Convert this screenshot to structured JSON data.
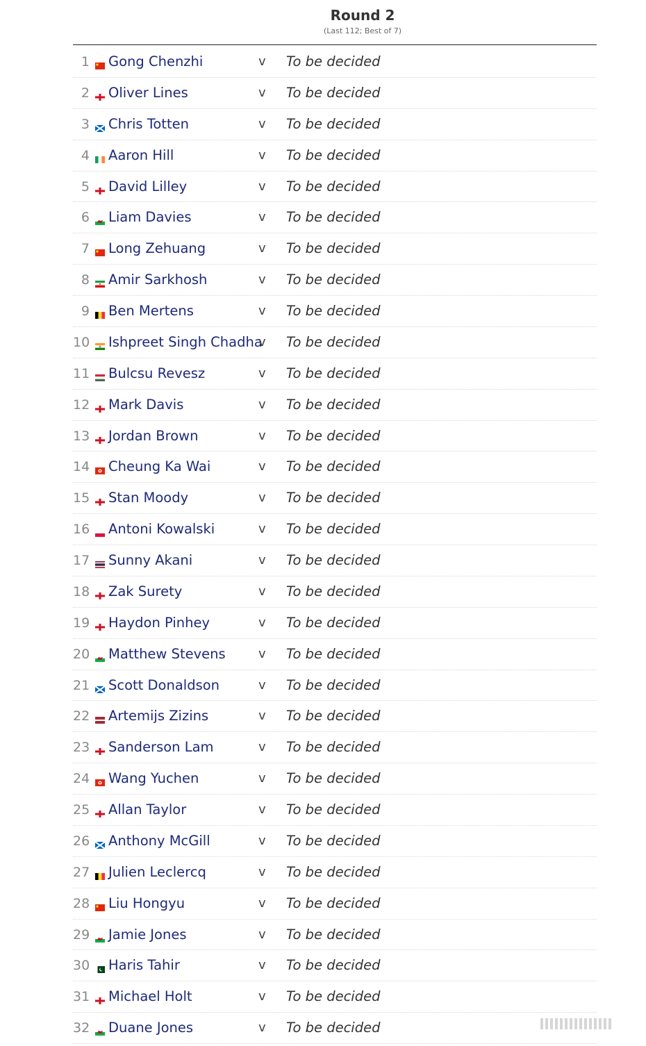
{
  "header": {
    "title": "Round 2",
    "subtitle": "(Last 112; Best of 7)"
  },
  "vs_label": "v",
  "flags": {
    "china": "#de2910",
    "england_bg": "#ffffff",
    "england_cross": "#ce1124",
    "scotland_bg": "#0065bd",
    "wales_green": "#00b140",
    "wales_red": "#d30731"
  },
  "matches": [
    {
      "num": "1",
      "flag": "china",
      "player": "Gong Chenzhi",
      "opponent": "To be decided"
    },
    {
      "num": "2",
      "flag": "england",
      "player": "Oliver Lines",
      "opponent": "To be decided"
    },
    {
      "num": "3",
      "flag": "scotland",
      "player": "Chris Totten",
      "opponent": "To be decided"
    },
    {
      "num": "4",
      "flag": "ireland",
      "player": "Aaron Hill",
      "opponent": "To be decided"
    },
    {
      "num": "5",
      "flag": "england",
      "player": "David Lilley",
      "opponent": "To be decided"
    },
    {
      "num": "6",
      "flag": "wales",
      "player": "Liam Davies",
      "opponent": "To be decided"
    },
    {
      "num": "7",
      "flag": "china",
      "player": "Long Zehuang",
      "opponent": "To be decided"
    },
    {
      "num": "8",
      "flag": "iran",
      "player": "Amir Sarkhosh",
      "opponent": "To be decided"
    },
    {
      "num": "9",
      "flag": "belgium",
      "player": "Ben Mertens",
      "opponent": "To be decided"
    },
    {
      "num": "10",
      "flag": "india",
      "player": "Ishpreet Singh Chadha",
      "opponent": "To be decided"
    },
    {
      "num": "11",
      "flag": "hungary",
      "player": "Bulcsu Revesz",
      "opponent": "To be decided"
    },
    {
      "num": "12",
      "flag": "england",
      "player": "Mark Davis",
      "opponent": "To be decided"
    },
    {
      "num": "13",
      "flag": "england",
      "player": "Jordan Brown",
      "opponent": "To be decided"
    },
    {
      "num": "14",
      "flag": "hongkong",
      "player": "Cheung Ka Wai",
      "opponent": "To be decided"
    },
    {
      "num": "15",
      "flag": "england",
      "player": "Stan Moody",
      "opponent": "To be decided"
    },
    {
      "num": "16",
      "flag": "poland",
      "player": "Antoni Kowalski",
      "opponent": "To be decided"
    },
    {
      "num": "17",
      "flag": "thailand",
      "player": "Sunny Akani",
      "opponent": "To be decided"
    },
    {
      "num": "18",
      "flag": "england",
      "player": "Zak Surety",
      "opponent": "To be decided"
    },
    {
      "num": "19",
      "flag": "england",
      "player": "Haydon Pinhey",
      "opponent": "To be decided"
    },
    {
      "num": "20",
      "flag": "wales",
      "player": "Matthew Stevens",
      "opponent": "To be decided"
    },
    {
      "num": "21",
      "flag": "scotland",
      "player": "Scott Donaldson",
      "opponent": "To be decided"
    },
    {
      "num": "22",
      "flag": "latvia",
      "player": "Artemijs Zizins",
      "opponent": "To be decided"
    },
    {
      "num": "23",
      "flag": "england",
      "player": "Sanderson Lam",
      "opponent": "To be decided"
    },
    {
      "num": "24",
      "flag": "hongkong",
      "player": "Wang Yuchen",
      "opponent": "To be decided"
    },
    {
      "num": "25",
      "flag": "england",
      "player": "Allan Taylor",
      "opponent": "To be decided"
    },
    {
      "num": "26",
      "flag": "scotland",
      "player": "Anthony McGill",
      "opponent": "To be decided"
    },
    {
      "num": "27",
      "flag": "belgium",
      "player": "Julien Leclercq",
      "opponent": "To be decided"
    },
    {
      "num": "28",
      "flag": "china",
      "player": "Liu Hongyu",
      "opponent": "To be decided"
    },
    {
      "num": "29",
      "flag": "wales",
      "player": "Jamie Jones",
      "opponent": "To be decided"
    },
    {
      "num": "30",
      "flag": "pakistan",
      "player": "Haris Tahir",
      "opponent": "To be decided"
    },
    {
      "num": "31",
      "flag": "england",
      "player": "Michael Holt",
      "opponent": "To be decided"
    },
    {
      "num": "32",
      "flag": "wales",
      "player": "Duane Jones",
      "opponent": "To be decided"
    }
  ]
}
